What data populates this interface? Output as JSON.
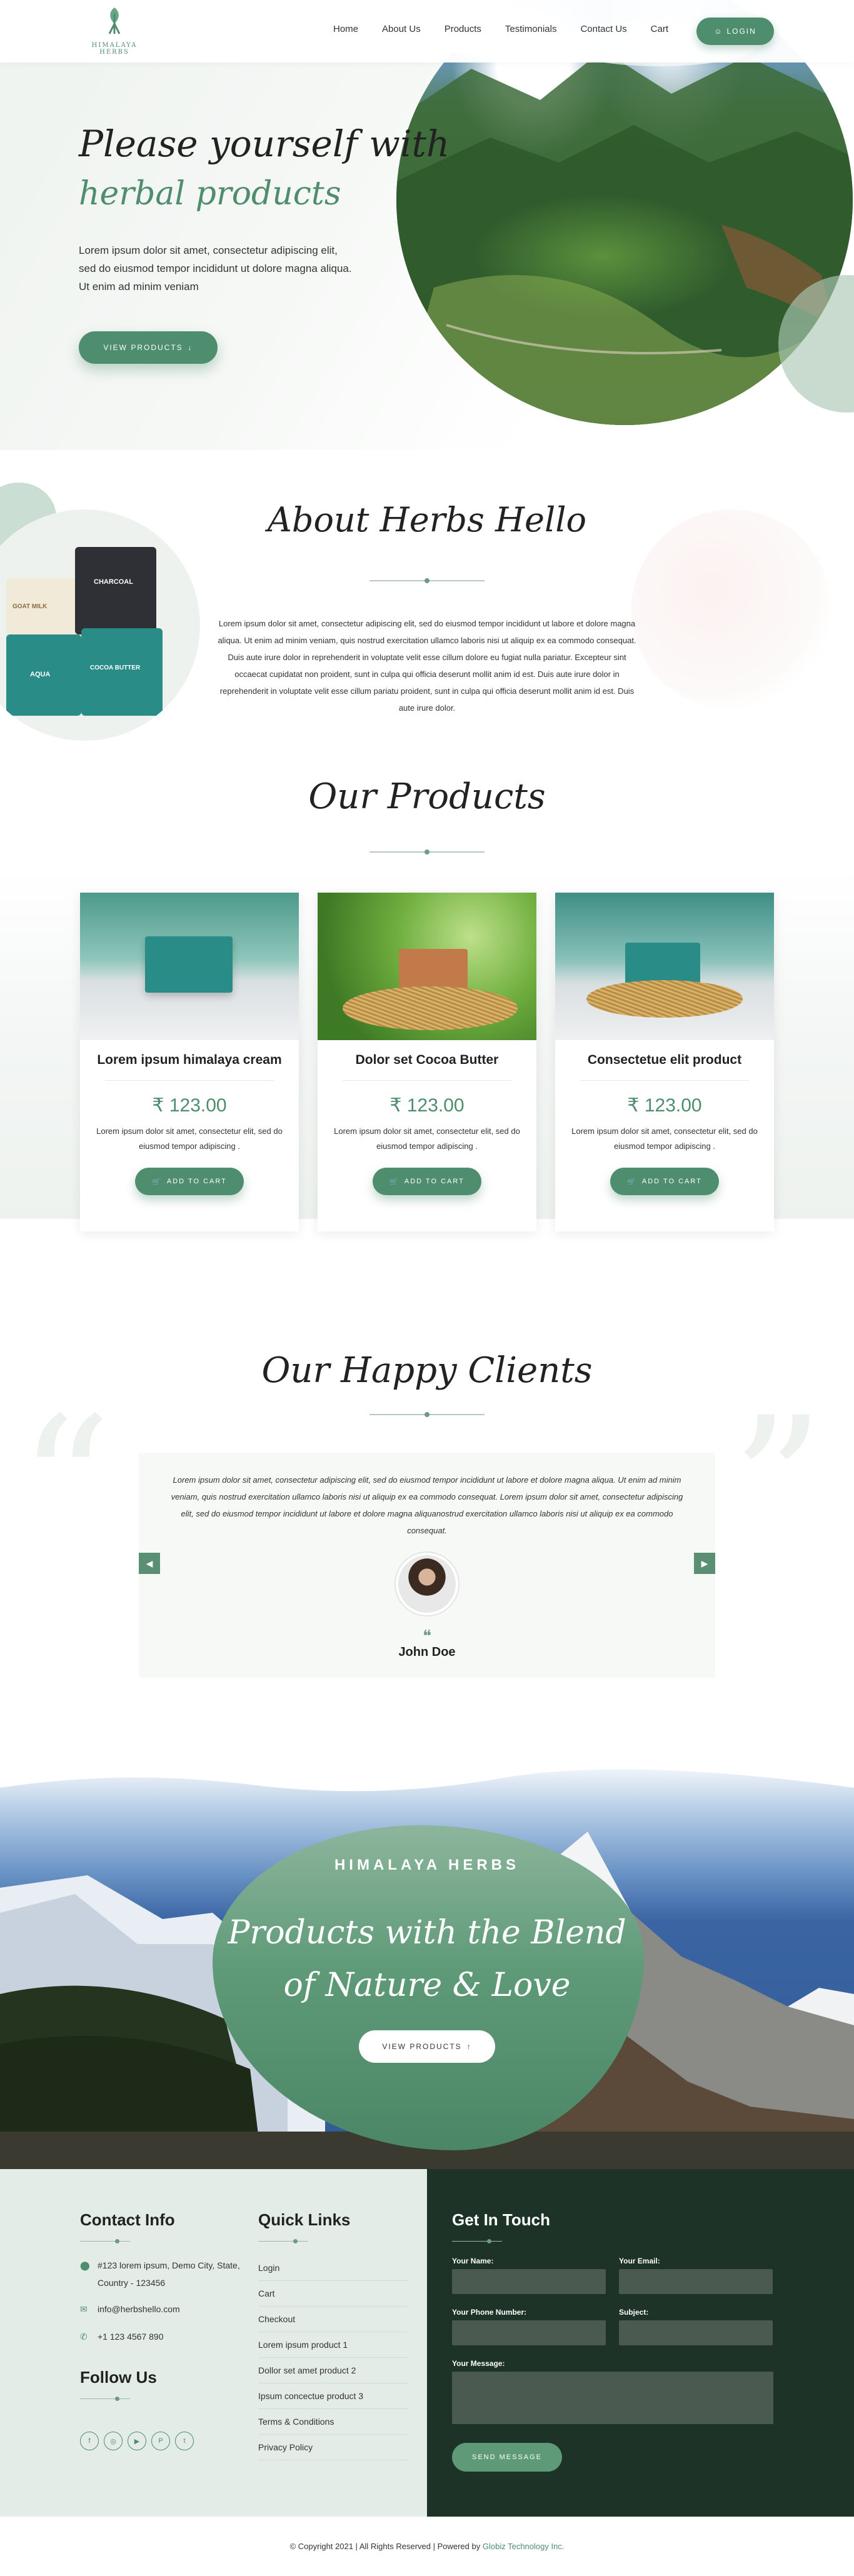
{
  "brand": {
    "logo_text": "HIMALAYA HERBS"
  },
  "nav": {
    "items": [
      "Home",
      "About Us",
      "Products",
      "Testimonials",
      "Contact Us",
      "Cart"
    ],
    "login_label": "LOGIN"
  },
  "hero": {
    "title_line1": "Please yourself with",
    "title_line2": "herbal products",
    "text": "Lorem ipsum dolor sit amet, consectetur adipiscing elit, sed do eiusmod tempor incididunt ut dolore magna aliqua. Ut enim ad minim veniam",
    "button_label": "VIEW PRODUCTS"
  },
  "about": {
    "title": "About Herbs Hello",
    "text": "Lorem ipsum dolor sit amet, consectetur adipiscing elit, sed do eiusmod tempor incididunt ut labore et dolore magna aliqua. Ut enim ad minim veniam, quis nostrud exercitation ullamco laboris nisi ut aliquip ex ea commodo consequat. Duis aute irure dolor in reprehenderit in voluptate velit esse cillum dolore eu fugiat nulla pariatur. Excepteur sint occaecat cupidatat non proident, sunt in culpa qui officia deserunt mollit anim id est. Duis aute irure dolor in reprehenderit in voluptate velit esse cillum pariatu proident, sunt in culpa qui officia deserunt mollit anim id est. Duis aute irure dolor.",
    "package_labels": [
      "GOAT MILK",
      "CHARCOAL",
      "AQUA",
      "COCOA BUTTER"
    ]
  },
  "products": {
    "title": "Our Products",
    "items": [
      {
        "name": "Lorem ipsum himalaya cream",
        "price": "₹ 123.00",
        "desc": "Lorem ipsum dolor sit amet, consectetur elit, sed do eiusmod tempor adipiscing .",
        "button": "ADD TO CART"
      },
      {
        "name": "Dolor set Cocoa Butter",
        "price": "₹ 123.00",
        "desc": "Lorem ipsum dolor sit amet, consectetur elit, sed do eiusmod tempor adipiscing .",
        "button": "ADD TO CART"
      },
      {
        "name": "Consectetue elit product",
        "price": "₹ 123.00",
        "desc": "Lorem ipsum dolor sit amet, consectetur elit, sed do eiusmod tempor adipiscing .",
        "button": "ADD TO CART"
      }
    ]
  },
  "testimonials": {
    "title": "Our Happy Clients",
    "quote": "Lorem ipsum dolor sit amet, consectetur adipiscing elit, sed do eiusmod tempor incididunt ut labore et dolore magna aliqua. Ut enim ad minim veniam, quis nostrud exercitation ullamco laboris nisi ut aliquip ex ea commodo consequat. Lorem ipsum dolor sit amet, consectetur adipiscing elit, sed do eiusmod tempor incididunt ut labore et dolore magna aliquanostrud exercitation ullamco laboris nisi ut aliquip ex ea commodo consequat.",
    "name": "John Doe",
    "prev": "◀",
    "next": "▶"
  },
  "banner": {
    "subtitle": "HIMALAYA HERBS",
    "title_line1": "Products with the Blend",
    "title_line2": "of Nature & Love",
    "button_label": "VIEW PRODUCTS"
  },
  "footer": {
    "contact_title": "Contact Info",
    "address": "#123 lorem ipsum, Demo City, State, Country - 123456",
    "email": "info@herbshello.com",
    "phone": "+1 123 4567 890",
    "follow_title": "Follow Us",
    "social": [
      "f",
      "◎",
      "▶",
      "P",
      "t"
    ],
    "links_title": "Quick Links",
    "links": [
      "Login",
      "Cart",
      "Checkout",
      "Lorem ipsum product 1",
      "Dollor set amet product 2",
      "Ipsum concectue product 3",
      "Terms & Conditions",
      "Privacy Policy"
    ],
    "form_title": "Get In Touch",
    "labels": {
      "name": "Your Name:",
      "email": "Your Email:",
      "phone": "Your Phone Number:",
      "subject": "Subject:",
      "message": "Your Message:"
    },
    "send_label": "SEND MESSAGE"
  },
  "copyright": {
    "text": "© Copyright 2021  |  All Rights Reserved  |  Powered by",
    "brand": "Globiz Technology Inc."
  },
  "colors": {
    "accent": "#4e8d6d",
    "dark": "#1d3327",
    "light": "#e4ece7"
  }
}
